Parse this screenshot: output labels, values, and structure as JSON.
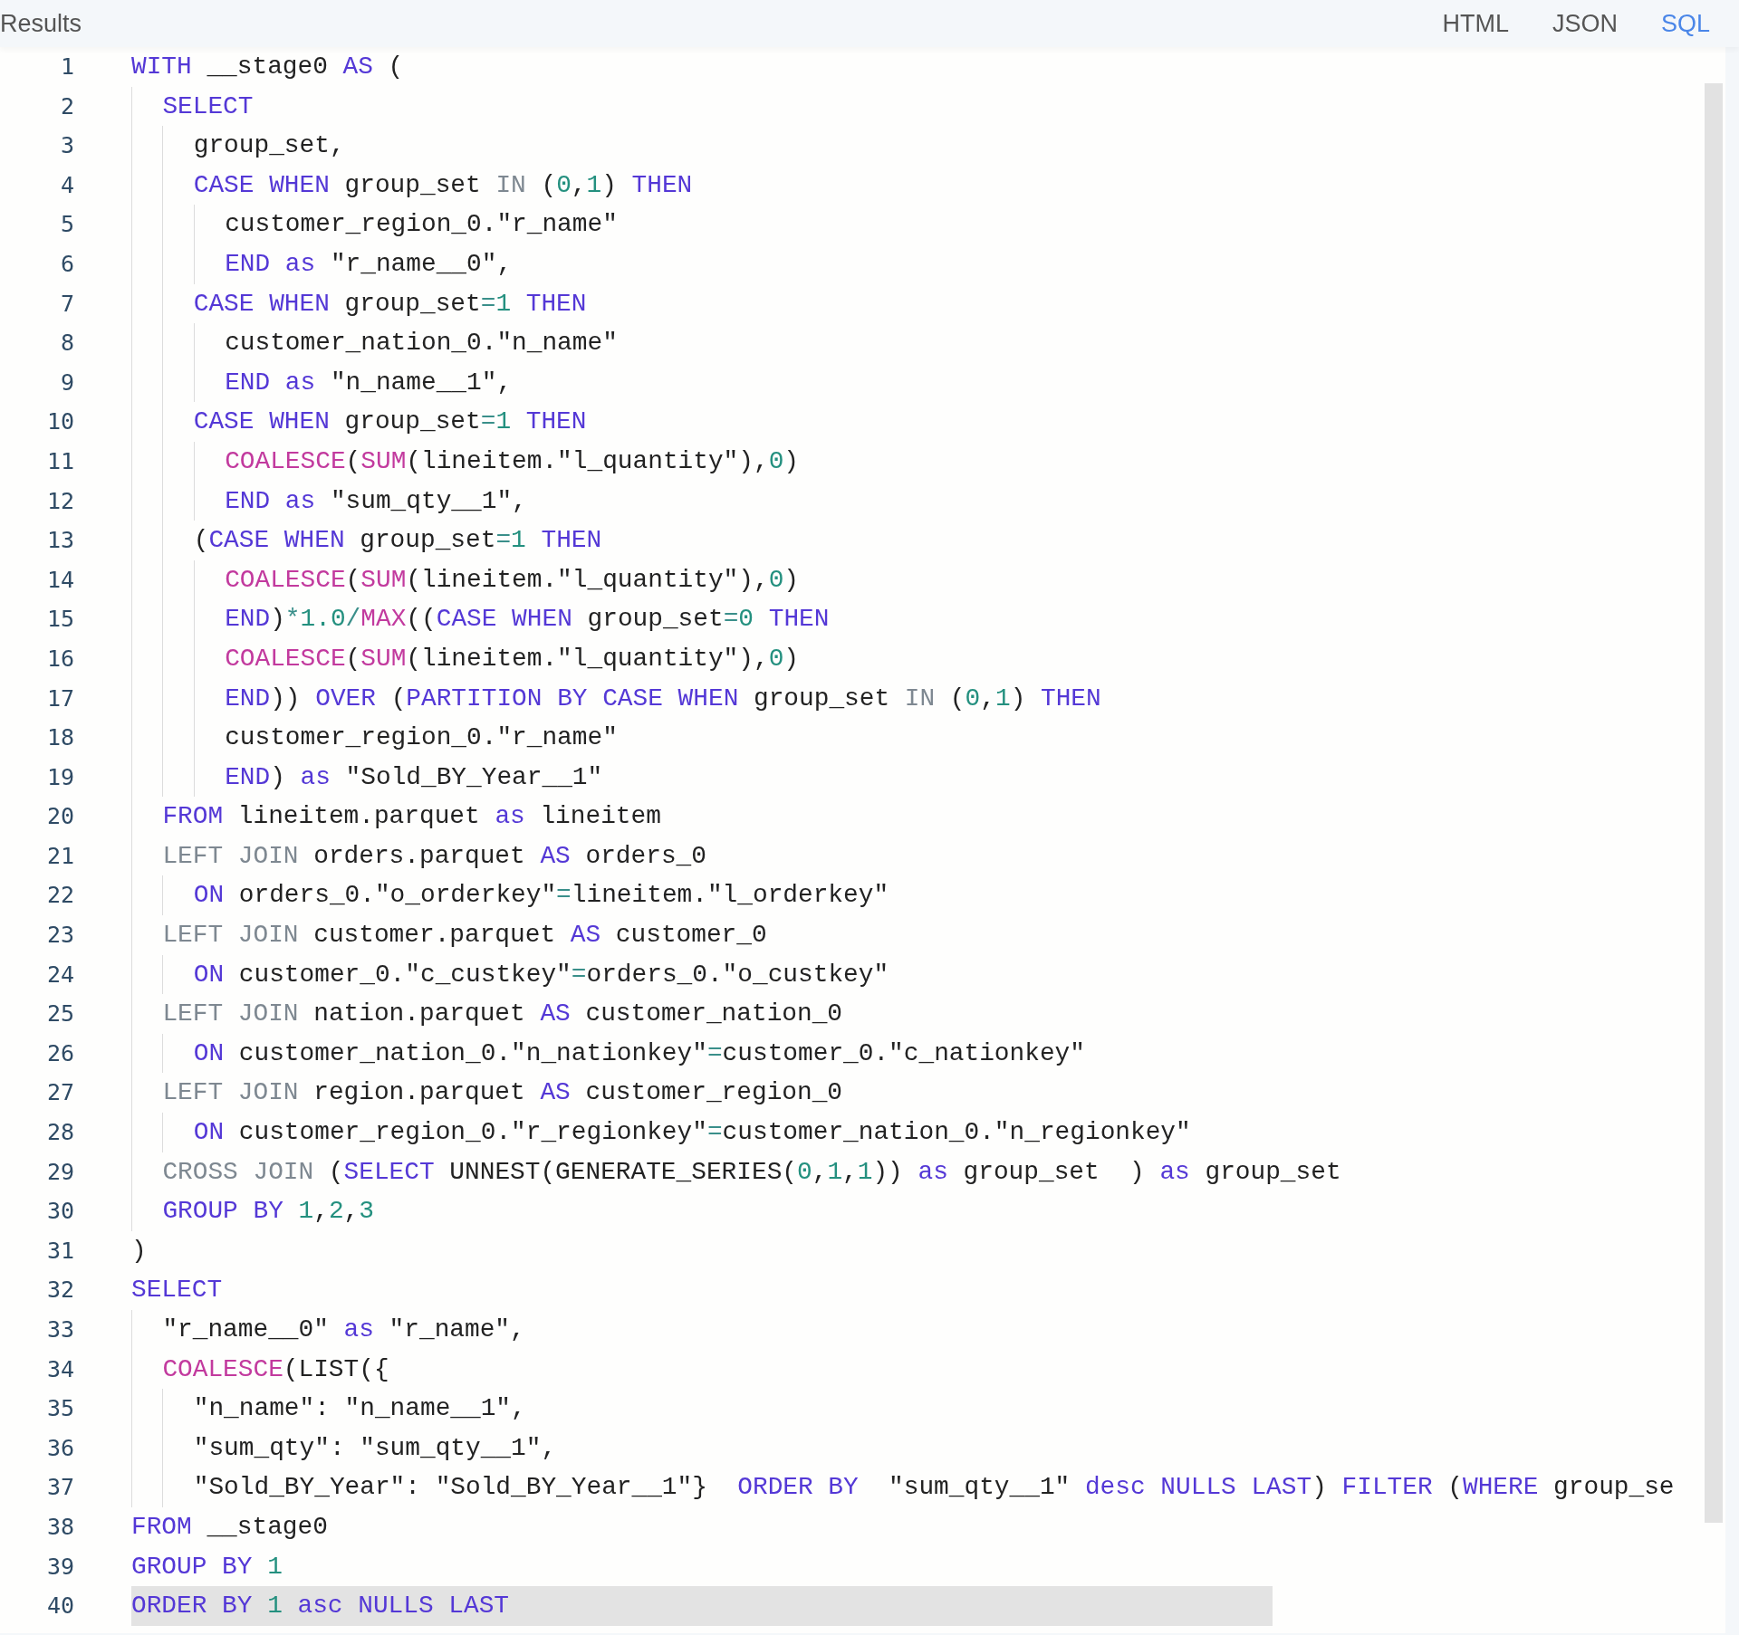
{
  "header": {
    "title": "Results",
    "tabs": [
      {
        "label": "HTML",
        "selected": false
      },
      {
        "label": "JSON",
        "selected": false
      },
      {
        "label": "SQL",
        "selected": true
      }
    ]
  },
  "editor": {
    "lines": [
      {
        "number": "1",
        "highlighted": false,
        "tokens": [
          {
            "kind": "kw",
            "text": "WITH"
          },
          {
            "kind": "txt",
            "text": " __stage0 "
          },
          {
            "kind": "kw",
            "text": "AS"
          },
          {
            "kind": "txt",
            "text": " ("
          }
        ]
      },
      {
        "number": "2",
        "highlighted": false,
        "tokens": [
          {
            "kind": "kw",
            "text": "  SELECT"
          }
        ]
      },
      {
        "number": "3",
        "highlighted": false,
        "tokens": [
          {
            "kind": "txt",
            "text": "    group_set,"
          }
        ]
      },
      {
        "number": "4",
        "highlighted": false,
        "tokens": [
          {
            "kind": "kw",
            "text": "    CASE WHEN"
          },
          {
            "kind": "txt",
            "text": " group_set "
          },
          {
            "kind": "dim",
            "text": "IN"
          },
          {
            "kind": "txt",
            "text": " ("
          },
          {
            "kind": "num",
            "text": "0"
          },
          {
            "kind": "txt",
            "text": ","
          },
          {
            "kind": "num",
            "text": "1"
          },
          {
            "kind": "txt",
            "text": ") "
          },
          {
            "kind": "kw",
            "text": "THEN"
          }
        ]
      },
      {
        "number": "5",
        "highlighted": false,
        "tokens": [
          {
            "kind": "txt",
            "text": "      customer_region_0.\"r_name\""
          }
        ]
      },
      {
        "number": "6",
        "highlighted": false,
        "tokens": [
          {
            "kind": "kw",
            "text": "      END as"
          },
          {
            "kind": "txt",
            "text": " \"r_name__0\","
          }
        ]
      },
      {
        "number": "7",
        "highlighted": false,
        "tokens": [
          {
            "kind": "kw",
            "text": "    CASE WHEN"
          },
          {
            "kind": "txt",
            "text": " group_set"
          },
          {
            "kind": "op",
            "text": "="
          },
          {
            "kind": "num",
            "text": "1"
          },
          {
            "kind": "kw",
            "text": " THEN"
          }
        ]
      },
      {
        "number": "8",
        "highlighted": false,
        "tokens": [
          {
            "kind": "txt",
            "text": "      customer_nation_0.\"n_name\""
          }
        ]
      },
      {
        "number": "9",
        "highlighted": false,
        "tokens": [
          {
            "kind": "kw",
            "text": "      END as"
          },
          {
            "kind": "txt",
            "text": " \"n_name__1\","
          }
        ]
      },
      {
        "number": "10",
        "highlighted": false,
        "tokens": [
          {
            "kind": "kw",
            "text": "    CASE WHEN"
          },
          {
            "kind": "txt",
            "text": " group_set"
          },
          {
            "kind": "op",
            "text": "="
          },
          {
            "kind": "num",
            "text": "1"
          },
          {
            "kind": "kw",
            "text": " THEN"
          }
        ]
      },
      {
        "number": "11",
        "highlighted": false,
        "tokens": [
          {
            "kind": "fn",
            "text": "      COALESCE"
          },
          {
            "kind": "txt",
            "text": "("
          },
          {
            "kind": "fn",
            "text": "SUM"
          },
          {
            "kind": "txt",
            "text": "(lineitem.\"l_quantity\"),"
          },
          {
            "kind": "num",
            "text": "0"
          },
          {
            "kind": "txt",
            "text": ")"
          }
        ]
      },
      {
        "number": "12",
        "highlighted": false,
        "tokens": [
          {
            "kind": "kw",
            "text": "      END as"
          },
          {
            "kind": "txt",
            "text": " \"sum_qty__1\","
          }
        ]
      },
      {
        "number": "13",
        "highlighted": false,
        "tokens": [
          {
            "kind": "txt",
            "text": "    ("
          },
          {
            "kind": "kw",
            "text": "CASE WHEN"
          },
          {
            "kind": "txt",
            "text": " group_set"
          },
          {
            "kind": "op",
            "text": "="
          },
          {
            "kind": "num",
            "text": "1"
          },
          {
            "kind": "kw",
            "text": " THEN"
          }
        ]
      },
      {
        "number": "14",
        "highlighted": false,
        "tokens": [
          {
            "kind": "fn",
            "text": "      COALESCE"
          },
          {
            "kind": "txt",
            "text": "("
          },
          {
            "kind": "fn",
            "text": "SUM"
          },
          {
            "kind": "txt",
            "text": "(lineitem.\"l_quantity\"),"
          },
          {
            "kind": "num",
            "text": "0"
          },
          {
            "kind": "txt",
            "text": ")"
          }
        ]
      },
      {
        "number": "15",
        "highlighted": false,
        "tokens": [
          {
            "kind": "kw",
            "text": "      END"
          },
          {
            "kind": "txt",
            "text": ")"
          },
          {
            "kind": "op",
            "text": "*"
          },
          {
            "kind": "num",
            "text": "1.0"
          },
          {
            "kind": "op",
            "text": "/"
          },
          {
            "kind": "fn",
            "text": "MAX"
          },
          {
            "kind": "txt",
            "text": "(("
          },
          {
            "kind": "kw",
            "text": "CASE WHEN"
          },
          {
            "kind": "txt",
            "text": " group_set"
          },
          {
            "kind": "op",
            "text": "="
          },
          {
            "kind": "num",
            "text": "0"
          },
          {
            "kind": "kw",
            "text": " THEN"
          }
        ]
      },
      {
        "number": "16",
        "highlighted": false,
        "tokens": [
          {
            "kind": "fn",
            "text": "      COALESCE"
          },
          {
            "kind": "txt",
            "text": "("
          },
          {
            "kind": "fn",
            "text": "SUM"
          },
          {
            "kind": "txt",
            "text": "(lineitem.\"l_quantity\"),"
          },
          {
            "kind": "num",
            "text": "0"
          },
          {
            "kind": "txt",
            "text": ")"
          }
        ]
      },
      {
        "number": "17",
        "highlighted": false,
        "tokens": [
          {
            "kind": "kw",
            "text": "      END"
          },
          {
            "kind": "txt",
            "text": ")) "
          },
          {
            "kind": "kw",
            "text": "OVER"
          },
          {
            "kind": "txt",
            "text": " ("
          },
          {
            "kind": "kw",
            "text": "PARTITION BY CASE WHEN"
          },
          {
            "kind": "txt",
            "text": " group_set "
          },
          {
            "kind": "dim",
            "text": "IN"
          },
          {
            "kind": "txt",
            "text": " ("
          },
          {
            "kind": "num",
            "text": "0"
          },
          {
            "kind": "txt",
            "text": ","
          },
          {
            "kind": "num",
            "text": "1"
          },
          {
            "kind": "txt",
            "text": ") "
          },
          {
            "kind": "kw",
            "text": "THEN"
          }
        ]
      },
      {
        "number": "18",
        "highlighted": false,
        "tokens": [
          {
            "kind": "txt",
            "text": "      customer_region_0.\"r_name\""
          }
        ]
      },
      {
        "number": "19",
        "highlighted": false,
        "tokens": [
          {
            "kind": "kw",
            "text": "      END"
          },
          {
            "kind": "txt",
            "text": ") "
          },
          {
            "kind": "kw",
            "text": "as"
          },
          {
            "kind": "txt",
            "text": " \"Sold_BY_Year__1\""
          }
        ]
      },
      {
        "number": "20",
        "highlighted": false,
        "tokens": [
          {
            "kind": "kw",
            "text": "  FROM"
          },
          {
            "kind": "txt",
            "text": " lineitem.parquet "
          },
          {
            "kind": "kw",
            "text": "as"
          },
          {
            "kind": "txt",
            "text": " lineitem"
          }
        ]
      },
      {
        "number": "21",
        "highlighted": false,
        "tokens": [
          {
            "kind": "dim",
            "text": "  LEFT JOIN"
          },
          {
            "kind": "txt",
            "text": " orders.parquet "
          },
          {
            "kind": "kw",
            "text": "AS"
          },
          {
            "kind": "txt",
            "text": " orders_0"
          }
        ]
      },
      {
        "number": "22",
        "highlighted": false,
        "tokens": [
          {
            "kind": "kw",
            "text": "    ON"
          },
          {
            "kind": "txt",
            "text": " orders_0.\"o_orderkey\""
          },
          {
            "kind": "op",
            "text": "="
          },
          {
            "kind": "txt",
            "text": "lineitem.\"l_orderkey\""
          }
        ]
      },
      {
        "number": "23",
        "highlighted": false,
        "tokens": [
          {
            "kind": "dim",
            "text": "  LEFT JOIN"
          },
          {
            "kind": "txt",
            "text": " customer.parquet "
          },
          {
            "kind": "kw",
            "text": "AS"
          },
          {
            "kind": "txt",
            "text": " customer_0"
          }
        ]
      },
      {
        "number": "24",
        "highlighted": false,
        "tokens": [
          {
            "kind": "kw",
            "text": "    ON"
          },
          {
            "kind": "txt",
            "text": " customer_0.\"c_custkey\""
          },
          {
            "kind": "op",
            "text": "="
          },
          {
            "kind": "txt",
            "text": "orders_0.\"o_custkey\""
          }
        ]
      },
      {
        "number": "25",
        "highlighted": false,
        "tokens": [
          {
            "kind": "dim",
            "text": "  LEFT JOIN"
          },
          {
            "kind": "txt",
            "text": " nation.parquet "
          },
          {
            "kind": "kw",
            "text": "AS"
          },
          {
            "kind": "txt",
            "text": " customer_nation_0"
          }
        ]
      },
      {
        "number": "26",
        "highlighted": false,
        "tokens": [
          {
            "kind": "kw",
            "text": "    ON"
          },
          {
            "kind": "txt",
            "text": " customer_nation_0.\"n_nationkey\""
          },
          {
            "kind": "op",
            "text": "="
          },
          {
            "kind": "txt",
            "text": "customer_0.\"c_nationkey\""
          }
        ]
      },
      {
        "number": "27",
        "highlighted": false,
        "tokens": [
          {
            "kind": "dim",
            "text": "  LEFT JOIN"
          },
          {
            "kind": "txt",
            "text": " region.parquet "
          },
          {
            "kind": "kw",
            "text": "AS"
          },
          {
            "kind": "txt",
            "text": " customer_region_0"
          }
        ]
      },
      {
        "number": "28",
        "highlighted": false,
        "tokens": [
          {
            "kind": "kw",
            "text": "    ON"
          },
          {
            "kind": "txt",
            "text": " customer_region_0.\"r_regionkey\""
          },
          {
            "kind": "op",
            "text": "="
          },
          {
            "kind": "txt",
            "text": "customer_nation_0.\"n_regionkey\""
          }
        ]
      },
      {
        "number": "29",
        "highlighted": false,
        "tokens": [
          {
            "kind": "dim",
            "text": "  CROSS JOIN"
          },
          {
            "kind": "txt",
            "text": " ("
          },
          {
            "kind": "kw",
            "text": "SELECT"
          },
          {
            "kind": "txt",
            "text": " UNNEST(GENERATE_SERIES("
          },
          {
            "kind": "num",
            "text": "0"
          },
          {
            "kind": "txt",
            "text": ","
          },
          {
            "kind": "num",
            "text": "1"
          },
          {
            "kind": "txt",
            "text": ","
          },
          {
            "kind": "num",
            "text": "1"
          },
          {
            "kind": "txt",
            "text": ")) "
          },
          {
            "kind": "kw",
            "text": "as"
          },
          {
            "kind": "txt",
            "text": " group_set  ) "
          },
          {
            "kind": "kw",
            "text": "as"
          },
          {
            "kind": "txt",
            "text": " group_set"
          }
        ]
      },
      {
        "number": "30",
        "highlighted": false,
        "tokens": [
          {
            "kind": "kw",
            "text": "  GROUP BY "
          },
          {
            "kind": "num",
            "text": "1"
          },
          {
            "kind": "txt",
            "text": ","
          },
          {
            "kind": "num",
            "text": "2"
          },
          {
            "kind": "txt",
            "text": ","
          },
          {
            "kind": "num",
            "text": "3"
          }
        ]
      },
      {
        "number": "31",
        "highlighted": false,
        "tokens": [
          {
            "kind": "txt",
            "text": ")"
          }
        ]
      },
      {
        "number": "32",
        "highlighted": false,
        "tokens": [
          {
            "kind": "kw",
            "text": "SELECT"
          }
        ]
      },
      {
        "number": "33",
        "highlighted": false,
        "tokens": [
          {
            "kind": "txt",
            "text": "  \"r_name__0\" "
          },
          {
            "kind": "kw",
            "text": "as"
          },
          {
            "kind": "txt",
            "text": " \"r_name\","
          }
        ]
      },
      {
        "number": "34",
        "highlighted": false,
        "tokens": [
          {
            "kind": "fn",
            "text": "  COALESCE"
          },
          {
            "kind": "txt",
            "text": "(LIST({"
          }
        ]
      },
      {
        "number": "35",
        "highlighted": false,
        "tokens": [
          {
            "kind": "txt",
            "text": "    \"n_name\": \"n_name__1\","
          }
        ]
      },
      {
        "number": "36",
        "highlighted": false,
        "tokens": [
          {
            "kind": "txt",
            "text": "    \"sum_qty\": \"sum_qty__1\","
          }
        ]
      },
      {
        "number": "37",
        "highlighted": false,
        "tokens": [
          {
            "kind": "txt",
            "text": "    \"Sold_BY_Year\": \"Sold_BY_Year__1\"}  "
          },
          {
            "kind": "kw",
            "text": "ORDER BY"
          },
          {
            "kind": "txt",
            "text": "  \"sum_qty__1\" "
          },
          {
            "kind": "kw",
            "text": "desc NULLS LAST"
          },
          {
            "kind": "txt",
            "text": ") "
          },
          {
            "kind": "kw",
            "text": "FILTER"
          },
          {
            "kind": "txt",
            "text": " ("
          },
          {
            "kind": "kw",
            "text": "WHERE"
          },
          {
            "kind": "txt",
            "text": " group_se"
          }
        ]
      },
      {
        "number": "38",
        "highlighted": false,
        "tokens": [
          {
            "kind": "kw",
            "text": "FROM"
          },
          {
            "kind": "txt",
            "text": " __stage0"
          }
        ]
      },
      {
        "number": "39",
        "highlighted": false,
        "tokens": [
          {
            "kind": "kw",
            "text": "GROUP BY "
          },
          {
            "kind": "num",
            "text": "1"
          }
        ]
      },
      {
        "number": "40",
        "highlighted": true,
        "tokens": [
          {
            "kind": "kw",
            "text": "ORDER BY "
          },
          {
            "kind": "num",
            "text": "1"
          },
          {
            "kind": "kw",
            "text": " asc NULLS LAST"
          }
        ]
      }
    ]
  }
}
